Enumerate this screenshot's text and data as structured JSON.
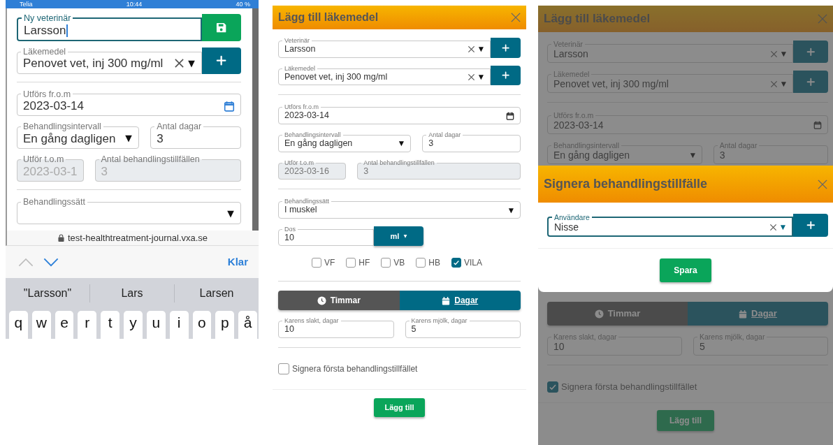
{
  "phone": {
    "status_bar": {
      "carrier": "Telia",
      "time": "10:44",
      "battery": "40 %"
    },
    "rows": [
      {
        "kind": "fields",
        "fields": [
          {
            "kind": "text",
            "label": "Ny veterinär",
            "value": "Larsson",
            "focused": true,
            "disabled": false,
            "button": {
              "kind": "save"
            }
          }
        ]
      },
      {
        "kind": "fields",
        "fields": [
          {
            "kind": "combo",
            "label": "Läkemedel",
            "value": "Penovet vet, inj 300 mg/ml",
            "focused": false,
            "disabled": false,
            "button": {
              "kind": "add"
            }
          }
        ]
      },
      {
        "kind": "divider"
      },
      {
        "kind": "fields",
        "fields": [
          {
            "kind": "date",
            "label": "Utförs fr.o.m",
            "value": "2023-03-14",
            "focused": false,
            "disabled": false
          }
        ]
      },
      {
        "kind": "fields",
        "fields": [
          {
            "kind": "select",
            "label": "Behandlingsintervall",
            "value": "En gång dagligen",
            "focused": false,
            "disabled": false
          },
          {
            "kind": "text",
            "label": "Antal dagar",
            "value": "3",
            "focused": false,
            "disabled": false
          }
        ]
      },
      {
        "kind": "fields",
        "fields": [
          {
            "kind": "date",
            "label": "Utför t.o.m",
            "value": "2023-03-1",
            "focused": false,
            "disabled": true
          },
          {
            "kind": "text",
            "label": "Antal behandlingstillfällen",
            "value": "3",
            "focused": false,
            "disabled": true
          }
        ]
      },
      {
        "kind": "divider"
      },
      {
        "kind": "fields",
        "fields": [
          {
            "kind": "select",
            "label": "Behandlingssätt",
            "focused": false,
            "disabled": false
          }
        ]
      }
    ],
    "address_bar": {
      "url": "test-healthtreatment-journal.vxa.se"
    },
    "keyboard_toolbar": {
      "done": "Klar"
    },
    "suggestions": [
      "\"Larsson\"",
      "Lars",
      "Larsen"
    ],
    "keys": [
      "q",
      "w",
      "e",
      "r",
      "t",
      "y",
      "u",
      "i",
      "o",
      "p",
      "å"
    ]
  },
  "add_dialog": {
    "title": "Lägg till läkemedel",
    "rows": [
      {
        "kind": "fields",
        "fields": [
          {
            "kind": "combo",
            "label": "Veterinär",
            "value": "Larsson",
            "focused": false,
            "disabled": false,
            "button": {
              "kind": "add"
            }
          }
        ]
      },
      {
        "kind": "fields",
        "fields": [
          {
            "kind": "combo",
            "label": "Läkemedel",
            "value": "Penovet vet, inj 300 mg/ml",
            "focused": false,
            "disabled": false,
            "button": {
              "kind": "add"
            }
          }
        ]
      },
      {
        "kind": "divider"
      },
      {
        "kind": "fields",
        "fields": [
          {
            "kind": "date",
            "label": "Utförs fr.o.m",
            "value": "2023-03-14",
            "focused": false,
            "disabled": false
          }
        ]
      },
      {
        "kind": "fields",
        "fields": [
          {
            "kind": "select",
            "label": "Behandlingsintervall",
            "value": "En gång dagligen",
            "focused": false,
            "disabled": false
          },
          {
            "kind": "text",
            "label": "Antal dagar",
            "value": "3",
            "focused": false,
            "disabled": false
          }
        ]
      },
      {
        "kind": "fields",
        "fields": [
          {
            "kind": "date",
            "label": "Utför t.o.m",
            "value": "2023-03-16",
            "focused": false,
            "disabled": true
          },
          {
            "kind": "text",
            "label": "Antal behandlingstillfällen",
            "value": "3",
            "focused": false,
            "disabled": true
          }
        ]
      },
      {
        "kind": "divider"
      },
      {
        "kind": "fields",
        "fields": [
          {
            "kind": "select",
            "label": "Behandlingssätt",
            "value": "I muskel",
            "focused": false,
            "disabled": false
          }
        ]
      },
      {
        "kind": "fields",
        "fields": [
          {
            "kind": "unit",
            "label": "Dos",
            "value": "10",
            "unit": "ml",
            "focused": false,
            "disabled": false
          }
        ]
      },
      {
        "kind": "checks",
        "items": [
          {
            "label": "VF",
            "checked": false
          },
          {
            "label": "HF",
            "checked": false
          },
          {
            "label": "VB",
            "checked": false
          },
          {
            "label": "HB",
            "checked": false
          },
          {
            "label": "VILA",
            "checked": true
          }
        ]
      },
      {
        "kind": "divider"
      },
      {
        "kind": "toggle",
        "options": [
          {
            "label": "Timmar",
            "selected": false
          },
          {
            "label": "Dagar",
            "selected": true
          }
        ]
      },
      {
        "kind": "fields",
        "fields": [
          {
            "kind": "text",
            "label": "Karens slakt, dagar",
            "value": "10",
            "focused": false,
            "disabled": false
          },
          {
            "kind": "text",
            "label": "Karens mjölk, dagar",
            "value": "5",
            "focused": false,
            "disabled": false
          }
        ]
      },
      {
        "kind": "divider"
      },
      {
        "kind": "check",
        "label": "Signera första behandlingstillfället",
        "checked": false
      }
    ],
    "submit": "Lägg till"
  },
  "sign_view": {
    "background": {
      "title": "Lägg till läkemedel",
      "rows_above": [
        {
          "kind": "fields",
          "fields": [
            {
              "kind": "combo",
              "label": "Veterinär",
              "value": "Larsson",
              "focused": false,
              "disabled": false,
              "button": {
                "kind": "add"
              }
            }
          ]
        },
        {
          "kind": "fields",
          "fields": [
            {
              "kind": "combo",
              "label": "Läkemedel",
              "value": "Penovet vet, inj 300 mg/ml",
              "focused": false,
              "disabled": false,
              "button": {
                "kind": "add"
              }
            }
          ]
        },
        {
          "kind": "divider"
        },
        {
          "kind": "fields",
          "fields": [
            {
              "kind": "date",
              "label": "Utförs fr.o.m",
              "value": "2023-03-14",
              "focused": false,
              "disabled": false
            }
          ]
        },
        {
          "kind": "fields",
          "fields": [
            {
              "kind": "select",
              "label": "Behandlingsintervall",
              "value": "En gång dagligen",
              "focused": false,
              "disabled": false
            },
            {
              "kind": "text",
              "label": "Antal dagar",
              "value": "3",
              "focused": false,
              "disabled": false
            }
          ]
        }
      ],
      "rows_below": [
        {
          "kind": "toggle",
          "options": [
            {
              "label": "Timmar",
              "selected": false
            },
            {
              "label": "Dagar",
              "selected": true
            }
          ]
        },
        {
          "kind": "fields",
          "fields": [
            {
              "kind": "text",
              "label": "Karens slakt, dagar",
              "value": "10",
              "focused": false,
              "disabled": false
            },
            {
              "kind": "text",
              "label": "Karens mjölk, dagar",
              "value": "5",
              "focused": false,
              "disabled": false
            }
          ]
        },
        {
          "kind": "divider"
        },
        {
          "kind": "check",
          "label": "Signera första behandlingstillfället",
          "checked": true
        }
      ],
      "submit": "Lägg till"
    },
    "modal": {
      "title": "Signera behandlingstillfälle",
      "fields": [
        {
          "kind": "combo",
          "label": "Användare",
          "value": "Nisse",
          "focused": true,
          "disabled": false,
          "button": {
            "kind": "add"
          }
        }
      ],
      "submit": "Spara"
    }
  }
}
